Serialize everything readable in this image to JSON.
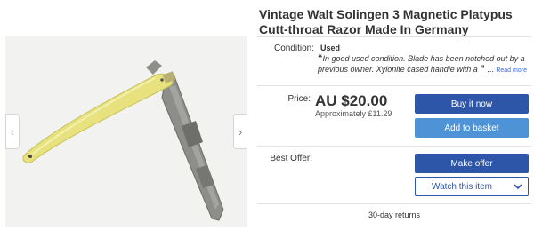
{
  "listing": {
    "title": "Vintage Walt Solingen 3 Magnetic Platypus Cutt-throat Razor Made In Germany"
  },
  "gallery": {
    "prev_icon": "chevron-left-icon",
    "next_icon": "chevron-right-icon",
    "prev_glyph": "‹",
    "next_glyph": "›"
  },
  "condition": {
    "label": "Condition:",
    "value": "Used",
    "open_quote": "“",
    "description": "In good used condition. Blade has been notched out by a previous owner. Xylonite cased handle with a",
    "close_quote": "”",
    "ellipsis": "...",
    "read_more": "Read more"
  },
  "price": {
    "label": "Price:",
    "amount": "AU $20.00",
    "approx": "Approximately £11.29"
  },
  "buttons": {
    "buy_now": "Buy it now",
    "add_to_basket": "Add to basket",
    "make_offer": "Make offer",
    "watch": "Watch this item",
    "watch_dropdown_icon": "chevron-down-icon"
  },
  "best_offer": {
    "label": "Best Offer:"
  },
  "returns": {
    "text": "30-day returns"
  },
  "colors": {
    "primary_button": "#2e56a8",
    "secondary_button": "#4e93d6",
    "handle": "#e6e07a",
    "blade": "#8a8a86"
  }
}
